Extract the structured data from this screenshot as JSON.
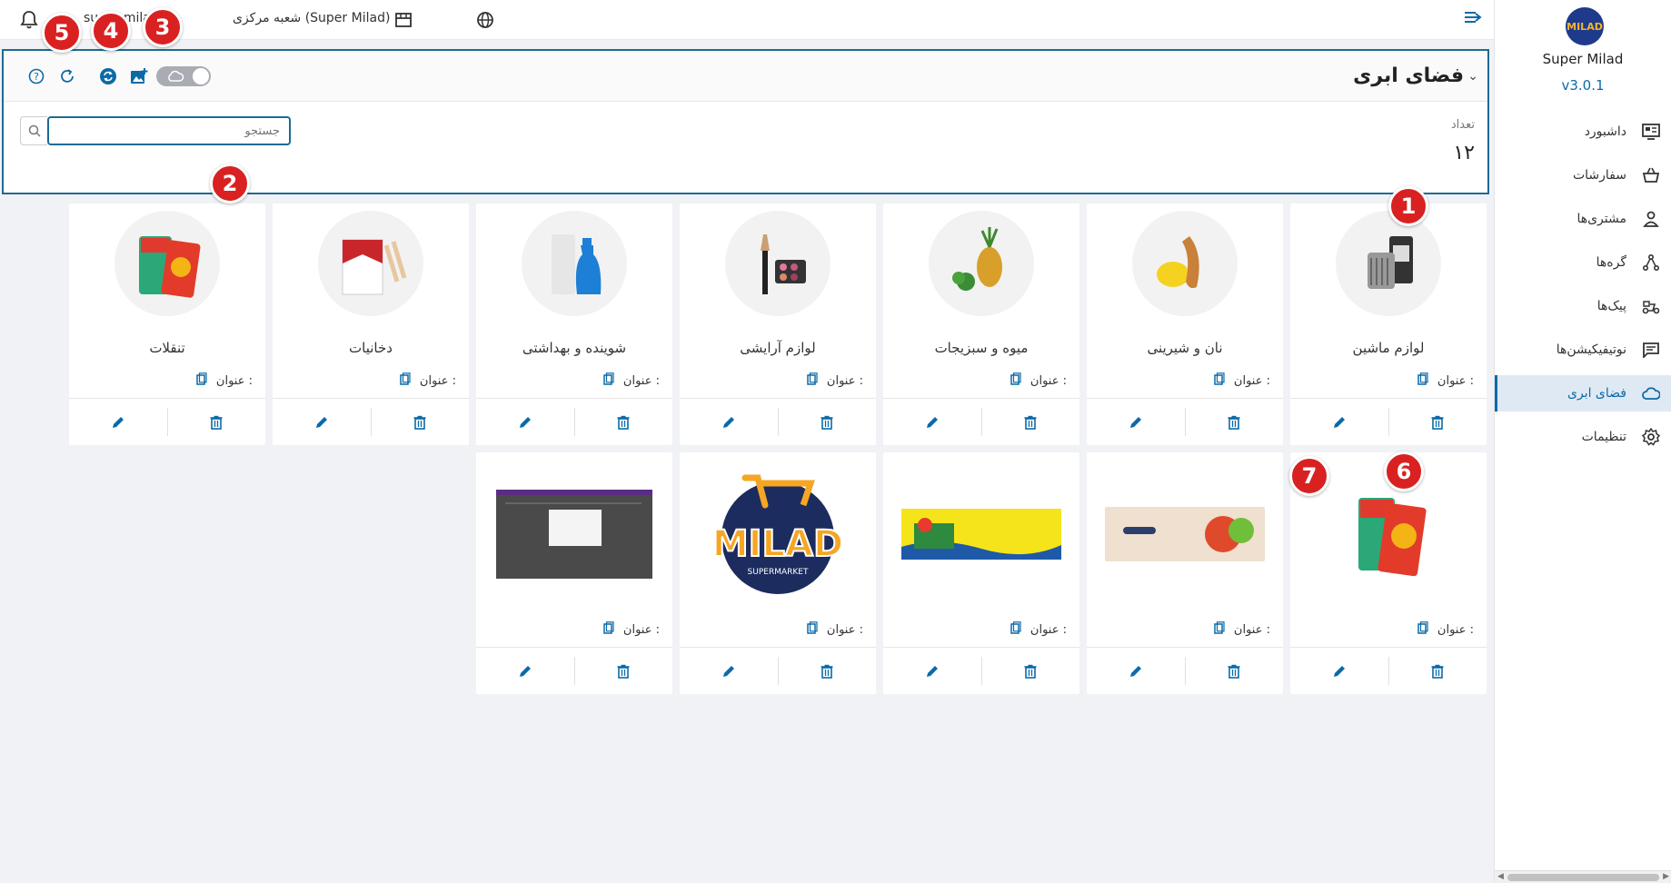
{
  "topbar": {
    "user": "super milad",
    "branch": "شعبه مرکزی (Super Milad)"
  },
  "sidebar": {
    "logo_text": "MILAD",
    "brand": "Super Milad",
    "version": "v3.0.1",
    "items": [
      {
        "label": "داشبورد",
        "icon": "dashboard-icon"
      },
      {
        "label": "سفارشات",
        "icon": "basket-icon"
      },
      {
        "label": "مشتری‌ها",
        "icon": "user-icon"
      },
      {
        "label": "گره‌ها",
        "icon": "nodes-icon"
      },
      {
        "label": "پیک‌ها",
        "icon": "courier-icon"
      },
      {
        "label": "نوتیفیکیشن‌ها",
        "icon": "notification-icon"
      },
      {
        "label": "فضای ابری",
        "icon": "cloud-icon",
        "active": true
      },
      {
        "label": "تنظیمات",
        "icon": "gear-icon"
      }
    ]
  },
  "panel": {
    "title": "فضای ابری",
    "count_label": "تعداد",
    "count_value": "۱۲",
    "search_placeholder": "جستجو"
  },
  "cards": {
    "title_label": "عنوان :",
    "row1": [
      {
        "name": "لوازم ماشین"
      },
      {
        "name": "نان و شیرینی"
      },
      {
        "name": "میوه و سبزیجات"
      },
      {
        "name": "لوازم آرایشی"
      },
      {
        "name": "شوینده و بهداشتی"
      },
      {
        "name": "دخانیات"
      },
      {
        "name": "تنقلات"
      }
    ]
  },
  "milad_logo": {
    "word": "MILAD",
    "sub": "SUPERMARKET"
  },
  "callouts": [
    "1",
    "2",
    "3",
    "4",
    "5",
    "6",
    "7"
  ],
  "colors": {
    "accent": "#0b6aa8",
    "callout": "#d92121",
    "panel_border": "#1e6a93"
  }
}
